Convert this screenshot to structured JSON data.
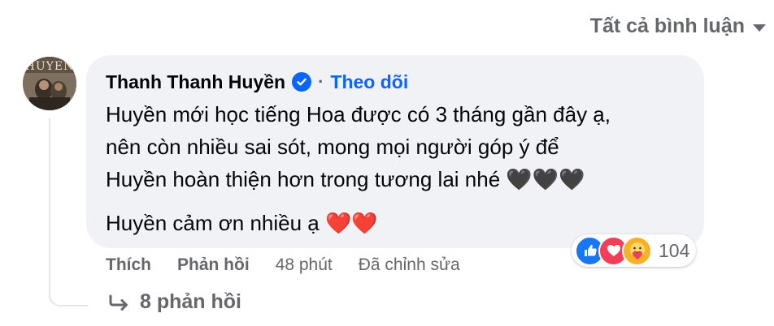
{
  "sort": {
    "label": "Tất cả bình luận"
  },
  "comment": {
    "author": "Thanh Thanh Huyền",
    "verified": true,
    "follow_label": "Theo dõi",
    "separator": "·",
    "lines": [
      "Huyền mới học tiếng Hoa được có 3 tháng gần đây ạ,",
      "nên còn nhiều sai sót, mong mọi người góp ý để",
      "Huyền hoàn thiện hơn trong tương lai nhé 🖤🖤🖤"
    ],
    "thanks_line": "Huyền cảm ơn nhiều ạ ❤️❤️",
    "avatar_lettering": "HUYEN",
    "reactions": {
      "icons": [
        "like-icon",
        "love-icon",
        "care-icon"
      ],
      "count": "104"
    },
    "actions": {
      "like_label": "Thích",
      "reply_label": "Phản hồi",
      "time": "48 phút",
      "edited": "Đã chỉnh sửa"
    },
    "replies_label": "8 phản hồi"
  },
  "colors": {
    "accent": "#0866ff",
    "bubble": "#f0f2f5",
    "muted": "#65676b",
    "like": "#1877f2",
    "love": "#f33e58",
    "care": "#f7b125"
  }
}
